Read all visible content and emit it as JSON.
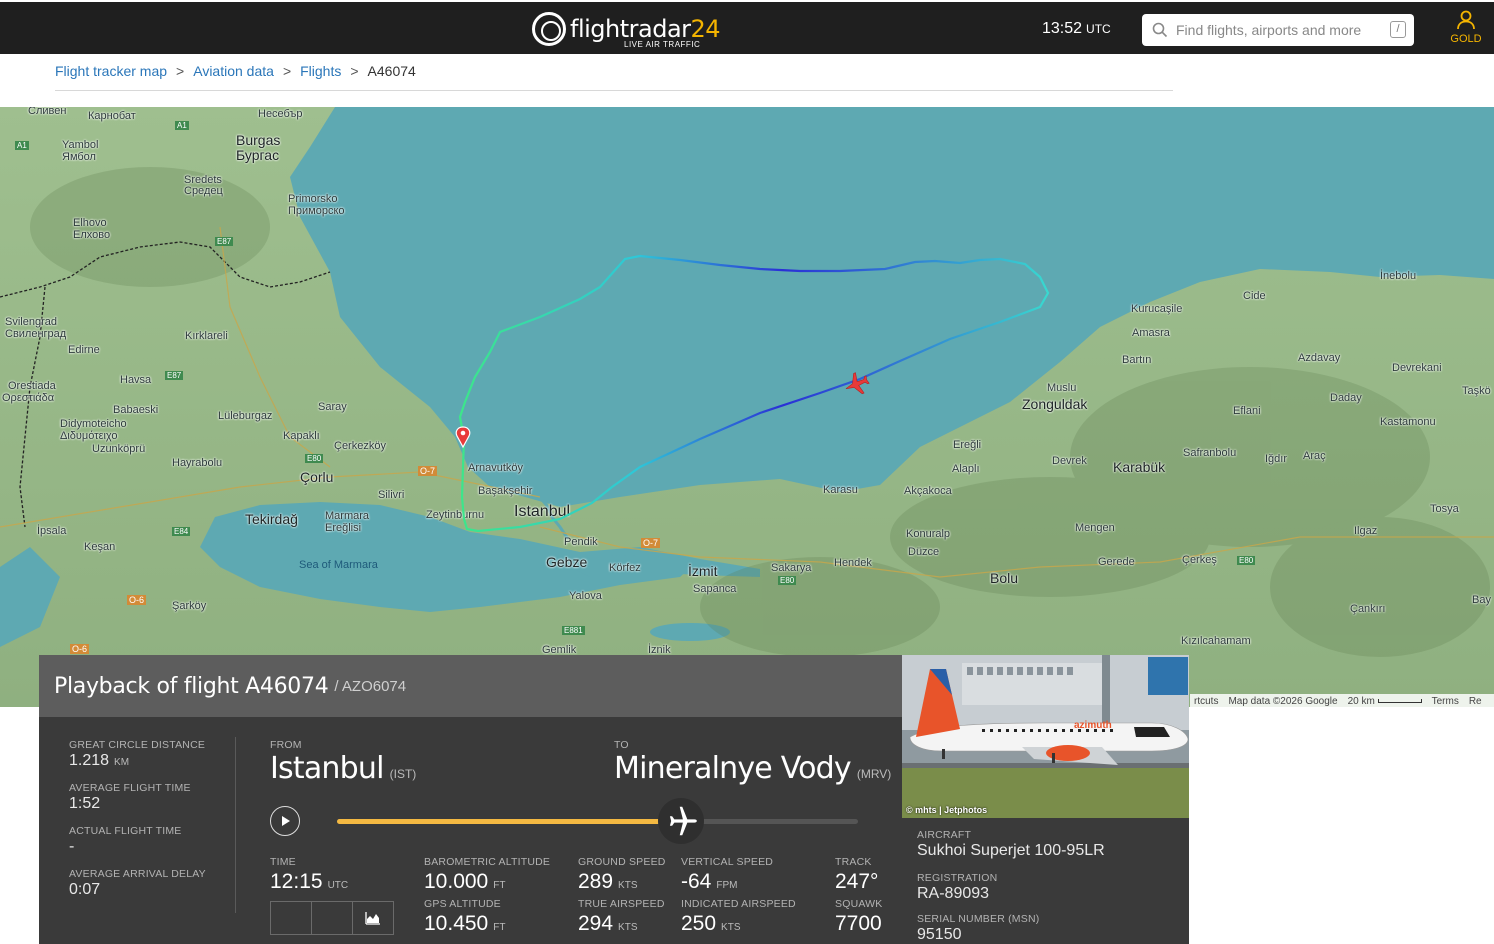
{
  "header": {
    "logo_word": "flightradar",
    "logo_num": "24",
    "logo_sub": "LIVE AIR TRAFFIC",
    "clock_time": "13:52",
    "clock_zone": "UTC",
    "search_placeholder": "Find flights, airports and more",
    "search_shortcut": "/",
    "account_label": "GOLD"
  },
  "breadcrumb": [
    {
      "label": "Flight tracker map"
    },
    {
      "label": "Aviation data"
    },
    {
      "label": "Flights"
    },
    {
      "label": "A46074"
    }
  ],
  "breadcrumb_sep": ">",
  "map": {
    "labels": {
      "sliven": "Сливен",
      "karnobat": "Карнобат",
      "nesebar": "Несебър",
      "burgas_en": "Burgas",
      "burgas_bg": "Бургас",
      "yambol_en": "Yambol",
      "yambol_bg": "Ямбол",
      "sredets_en": "Sredets",
      "sredets_bg": "Средец",
      "primorsko_en": "Primorsko",
      "primorsko_bg": "Приморско",
      "elhovo_en": "Elhovo",
      "elhovo_bg": "Елхово",
      "svilengrad_en": "Svilengrad",
      "svilengrad_bg": "Свиленград",
      "kirklareli": "Kırklareli",
      "edirne": "Edirne",
      "orestiada_en": "Orestiada",
      "orestiada_gr": "Ορεστιάδα",
      "havsa": "Havsa",
      "babaeski": "Babaeski",
      "luleburgaz": "Lüleburgaz",
      "saray": "Saray",
      "didymoteicho_en": "Didymoteicho",
      "didymoteicho_gr": "Διδυμότειχο",
      "uzunkopru": "Uzunköprü",
      "kapakli": "Kapaklı",
      "cerkezkoy": "Çerkezköy",
      "hayrabolu": "Hayrabolu",
      "corlu": "Çorlu",
      "arnavutkoy": "Arnavutköy",
      "basaksehir": "Başakşehir",
      "silivri": "Silivri",
      "tekirdag": "Tekirdağ",
      "marmara_ereglisi_1": "Marmara",
      "marmara_ereglisi_2": "Ereğlisi",
      "zeytinburnu": "Zeytinburnu",
      "istanbul": "Istanbul",
      "ipsala": "İpsala",
      "kesan": "Keşan",
      "sea_of_marmara": "Sea of Marmara",
      "sarkoy": "Şarköy",
      "pendik": "Pendik",
      "gebze": "Gebze",
      "korfez": "Körfez",
      "izmit": "İzmit",
      "yalova": "Yalova",
      "sapanca": "Sapanca",
      "sakarya": "Sakarya",
      "hendek": "Hendek",
      "gemlik": "Gemlik",
      "iznik": "İznik",
      "karasu": "Karasu",
      "akcakoca": "Akçakoca",
      "konuralp": "Konuralp",
      "duzce": "Düzce",
      "bolu": "Bolu",
      "eregli": "Ereğli",
      "alapli": "Alaplı",
      "zonguldak": "Zonguldak",
      "devrek": "Devrek",
      "karabuk": "Karabük",
      "mengen": "Mengen",
      "gerede": "Gerede",
      "cerkes": "Çerkeş",
      "musu": "Muslu",
      "bartin": "Bartın",
      "amasra": "Amasra",
      "kurucasile": "Kurucaşile",
      "cide": "Cide",
      "inebolu": "İnebolu",
      "azdavay": "Azdavay",
      "devrekani": "Devrekani",
      "daday": "Daday",
      "eflani": "Eflani",
      "safranbolu": "Safranbolu",
      "igdir": "Iğdır",
      "arac": "Araç",
      "kastamonu": "Kastamonu",
      "tasko": "Taşkö",
      "tosya": "Tosya",
      "ilgaz": "Ilgaz",
      "cankiri": "Çankırı",
      "kizilcahamam": "Kızılcahamam",
      "bay": "Bay",
      "e80": "E80",
      "e87": "E87",
      "e84": "E84",
      "e881": "E881",
      "o7": "O-7",
      "o6": "O-6",
      "a1": "A1"
    },
    "attribution": {
      "shortcuts": "rtcuts",
      "data": "Map data ©2026 Google",
      "scale": "20 km",
      "terms": "Terms",
      "report": "Re"
    }
  },
  "playback": {
    "title": "Playback of flight A46074",
    "callsign": "/ AZO6074",
    "great_circle_label": "GREAT CIRCLE DISTANCE",
    "great_circle_value": "1.218",
    "great_circle_unit": "KM",
    "avg_time_label": "AVERAGE FLIGHT TIME",
    "avg_time_value": "1:52",
    "actual_time_label": "ACTUAL FLIGHT TIME",
    "actual_time_value": "-",
    "avg_delay_label": "AVERAGE ARRIVAL DELAY",
    "avg_delay_value": "0:07",
    "from_label": "FROM",
    "from_city": "Istanbul",
    "from_code": "(IST)",
    "to_label": "TO",
    "to_city": "Mineralnye Vody",
    "to_code": "(MRV)",
    "progress": 0.66,
    "time_label": "TIME",
    "time_value": "12:15",
    "time_unit": "UTC",
    "baro_alt_label": "BAROMETRIC ALTITUDE",
    "baro_alt_value": "10.000",
    "baro_alt_unit": "FT",
    "gps_alt_label": "GPS ALTITUDE",
    "gps_alt_value": "10.450",
    "gps_alt_unit": "FT",
    "ground_speed_label": "GROUND SPEED",
    "ground_speed_value": "289",
    "ground_speed_unit": "KTS",
    "true_airspeed_label": "TRUE AIRSPEED",
    "true_airspeed_value": "294",
    "true_airspeed_unit": "KTS",
    "vertical_speed_label": "VERTICAL SPEED",
    "vertical_speed_value": "-64",
    "vertical_speed_unit": "FPM",
    "indicated_airspeed_label": "INDICATED AIRSPEED",
    "indicated_airspeed_value": "250",
    "indicated_airspeed_unit": "KTS",
    "track_label": "TRACK",
    "track_value": "247°",
    "squawk_label": "SQUAWK",
    "squawk_value": "7700"
  },
  "aircraft": {
    "photo_credit": "© mhts | Jetphotos",
    "livery_text": "azimuth",
    "aircraft_label": "AIRCRAFT",
    "aircraft_value": "Sukhoi Superjet 100-95LR",
    "registration_label": "REGISTRATION",
    "registration_value": "RA-89093",
    "serial_label": "SERIAL NUMBER (MSN)",
    "serial_value": "95150"
  },
  "colors": {
    "track_start": "#3de68a",
    "track_mid": "#2ec8d8",
    "track_high": "#2a2fd6",
    "progress_fill": "#f4b942",
    "aircraft_marker": "#e83a3a",
    "brand_accent": "#f4b400"
  }
}
